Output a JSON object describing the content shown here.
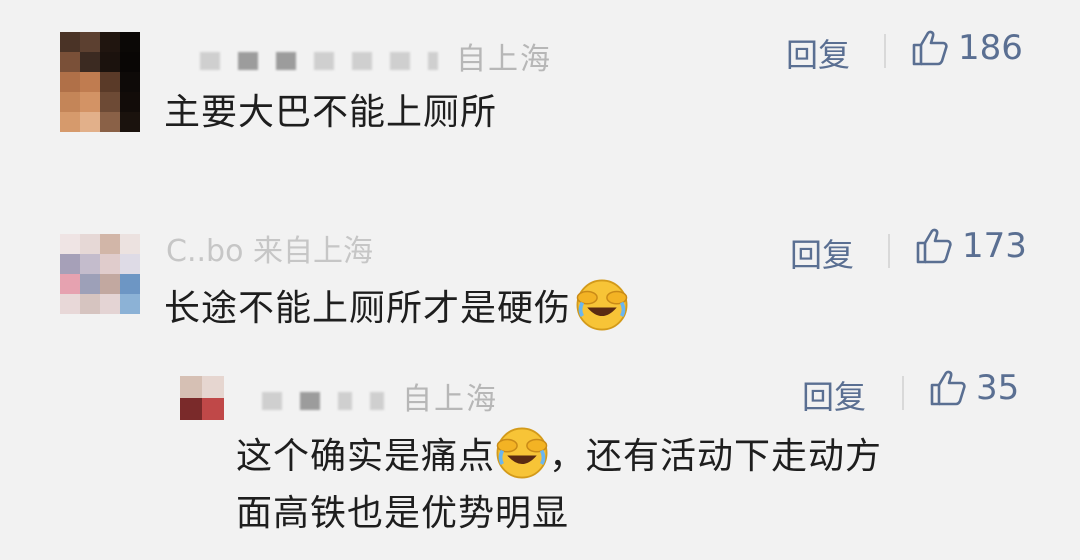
{
  "comments": [
    {
      "location": "自上海",
      "reply_label": "回复",
      "likes": "186",
      "text": "主要大巴不能上厕所"
    },
    {
      "name_fragment": "C..bo 来自上海",
      "reply_label": "回复",
      "likes": "173",
      "text": "长途不能上厕所才是硬伤"
    },
    {
      "location": "自上海",
      "reply_label": "回复",
      "likes": "35",
      "text_part1": "这个确实是痛点",
      "text_part2": "，还有活动下走动方",
      "text_line2": "面高铁也是优势明显"
    }
  ],
  "icons": {
    "like": "thumbs-up-icon",
    "emoji": "face-with-tears-of-joy-covering-eyes-icon"
  },
  "colors": {
    "background": "#f2f2f2",
    "action_text": "#5a6f92",
    "body_text": "#1e1e1e",
    "meta_text": "#b7b7b7"
  }
}
